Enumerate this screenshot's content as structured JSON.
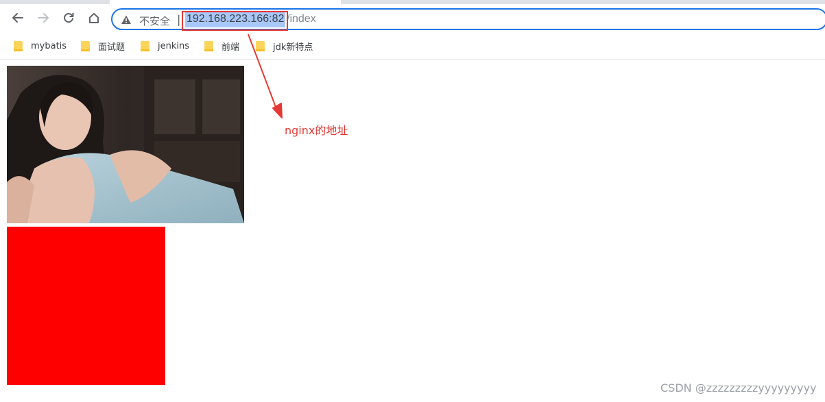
{
  "browser": {
    "nav": {
      "back_icon": "arrow-left-icon",
      "forward_icon": "arrow-right-icon",
      "reload_icon": "reload-icon",
      "home_icon": "home-icon"
    },
    "address_bar": {
      "security_icon": "warning-triangle-icon",
      "security_label": "不安全",
      "separator": "|",
      "url_host": "192.168.223.166:82",
      "url_path": "/index",
      "focus_color": "#1a73e8",
      "selection_color": "#a8c7fa"
    },
    "bookmarks": [
      {
        "label": "mybatis",
        "icon": "folder-icon"
      },
      {
        "label": "面试题",
        "icon": "folder-icon"
      },
      {
        "label": "jenkins",
        "icon": "folder-icon"
      },
      {
        "label": "前端",
        "icon": "folder-icon"
      },
      {
        "label": "jdk新特点",
        "icon": "folder-icon"
      }
    ]
  },
  "page": {
    "image": {
      "subject": "photo"
    },
    "block_color": "#ff0000"
  },
  "annotation": {
    "text": "nginx的地址",
    "color": "#e53935"
  },
  "watermark": "CSDN @zzzzzzzzzyyyyyyyyy"
}
